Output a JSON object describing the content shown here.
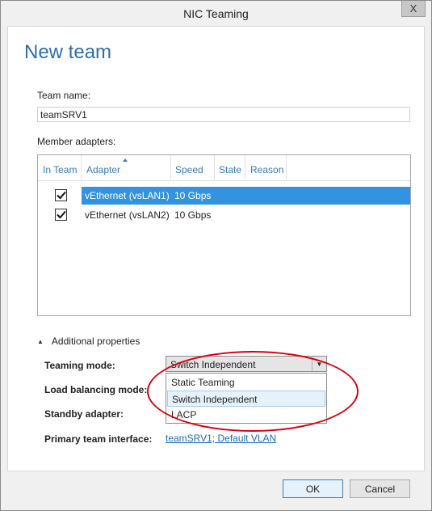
{
  "window": {
    "title": "NIC Teaming",
    "close_glyph": "X"
  },
  "page": {
    "heading": "New team",
    "team_name_label": "Team name:",
    "team_name_value": "teamSRV1",
    "member_adapters_label": "Member adapters:"
  },
  "adapters_table": {
    "columns": [
      "In Team",
      "Adapter",
      "Speed",
      "State",
      "Reason"
    ],
    "sorted_by": "Adapter",
    "rows": [
      {
        "in_team": true,
        "adapter": "vEthernet (vsLAN1)",
        "speed": "10 Gbps",
        "state": "",
        "reason": "",
        "selected": true
      },
      {
        "in_team": true,
        "adapter": "vEthernet (vsLAN2)",
        "speed": "10 Gbps",
        "state": "",
        "reason": "",
        "selected": false
      }
    ]
  },
  "additional_properties": {
    "toggle_label": "Additional properties",
    "teaming_mode_label": "Teaming mode:",
    "load_balancing_label": "Load balancing mode:",
    "standby_adapter_label": "Standby adapter:",
    "primary_interface_label": "Primary team interface:",
    "teaming_mode_selected": "Switch Independent",
    "teaming_mode_options": [
      "Static Teaming",
      "Switch Independent",
      "LACP"
    ],
    "teaming_mode_highlighted": "Switch Independent",
    "primary_interface_link": "teamSRV1; Default VLAN"
  },
  "footer": {
    "ok_label": "OK",
    "cancel_label": "Cancel"
  },
  "colors": {
    "heading_blue": "#2f6ea4",
    "selection_blue": "#3393df",
    "annotation_red": "#d8000f"
  }
}
